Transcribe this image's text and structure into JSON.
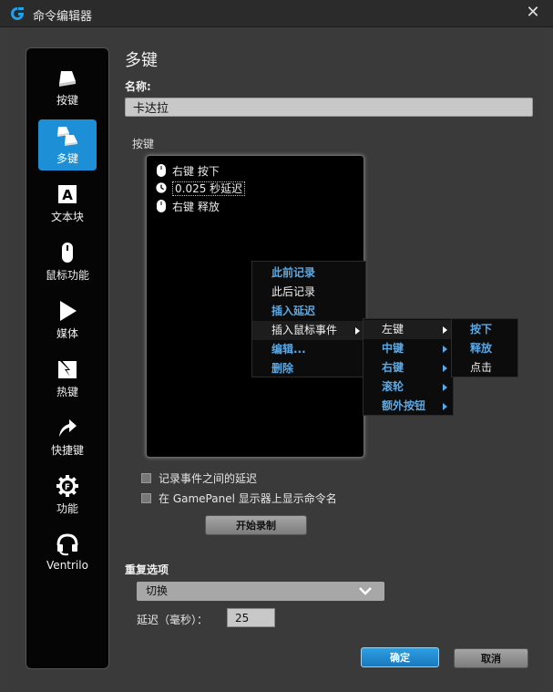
{
  "window": {
    "title": "命令编辑器"
  },
  "nav": {
    "items": [
      {
        "label": "按键",
        "icon": "keystroke-icon"
      },
      {
        "label": "多键",
        "icon": "multikey-icon",
        "active": true
      },
      {
        "label": "文本块",
        "icon": "text-block-icon"
      },
      {
        "label": "鼠标功能",
        "icon": "mouse-icon"
      },
      {
        "label": "媒体",
        "icon": "media-play-icon"
      },
      {
        "label": "热键",
        "icon": "hotkey-icon"
      },
      {
        "label": "快捷键",
        "icon": "shortcut-arrow-icon"
      },
      {
        "label": "功能",
        "icon": "function-gear-icon"
      },
      {
        "label": "Ventrilo",
        "icon": "ventrilo-headset-icon"
      }
    ]
  },
  "panel": {
    "heading": "多键",
    "name_label": "名称:",
    "name_value": "卡达拉",
    "keys_label": "按键"
  },
  "events": [
    {
      "text": "右键 按下",
      "icon": "mouse-icon"
    },
    {
      "text": "0.025 秒延迟",
      "icon": "clock-icon",
      "selected": true
    },
    {
      "text": "右键 释放",
      "icon": "mouse-icon"
    }
  ],
  "context_menu": {
    "items": [
      "此前记录",
      "此后记录",
      "插入延迟",
      "插入鼠标事件",
      "编辑...",
      "删除"
    ]
  },
  "mouse_menu": {
    "items": [
      "左键",
      "中键",
      "右键",
      "滚轮",
      "额外按钮"
    ]
  },
  "action_menu": {
    "items": [
      "按下",
      "释放",
      "点击"
    ]
  },
  "options": {
    "record_delay": "记录事件之间的延迟",
    "show_name": "在 GamePanel 显示器上显示命令名",
    "start_record": "开始录制"
  },
  "repeat": {
    "title": "重复选项",
    "mode": "切换",
    "delay_label": "延迟（毫秒）：",
    "delay_value": "25"
  },
  "buttons": {
    "ok": "确定",
    "cancel": "取消"
  },
  "colors": {
    "accent": "#1c8fd6",
    "menu_blue": "#5aa9e6"
  }
}
